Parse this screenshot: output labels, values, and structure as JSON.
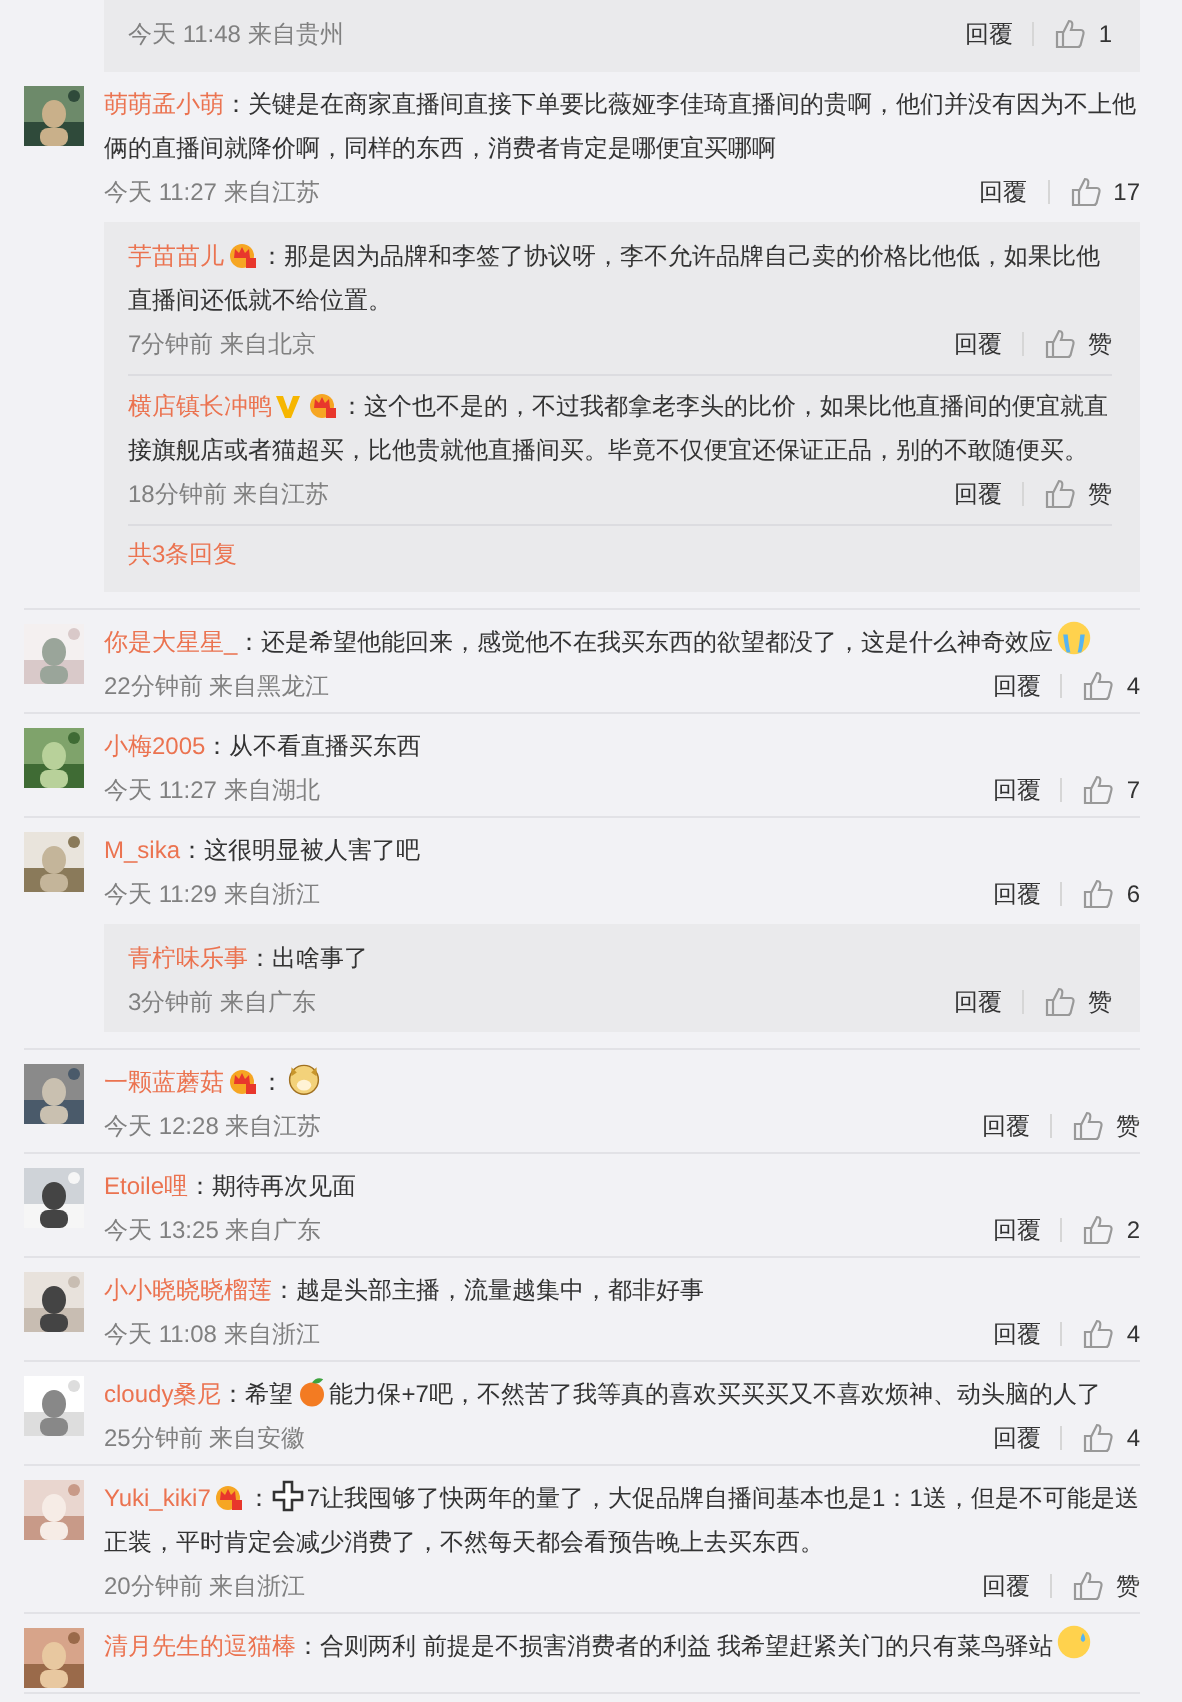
{
  "top_fragment": {
    "meta": "今天 11:48 来自贵州",
    "reply_label": "回覆",
    "likes": "1"
  },
  "comments": [
    {
      "name": "萌萌孟小萌",
      "segments": [
        {
          "kind": "text",
          "value": "：关键是在商家直播间直接下单要比薇娅李佳琦直播间的贵啊，他们并没有因为不上他俩的直播间就降价啊，同样的东西，消费者肯定是哪便宜买哪啊"
        }
      ],
      "meta": "今天 11:27 来自江苏",
      "reply_label": "回覆",
      "likes": "17",
      "replies": [
        {
          "name": "芋苗苗儿",
          "badges": [
            {
              "kind": "member"
            }
          ],
          "segments": [
            {
              "kind": "text",
              "value": "：那是因为品牌和李签了协议呀，李不允许品牌自己卖的价格比他低，如果比他直播间还低就不给位置。"
            }
          ],
          "meta": "7分钟前 来自北京",
          "reply_label": "回覆",
          "likes": "赞"
        },
        {
          "name": "横店镇长冲鸭",
          "badges": [
            {
              "kind": "verified"
            },
            {
              "kind": "member"
            }
          ],
          "segments": [
            {
              "kind": "text",
              "value": "：这个也不是的，不过我都拿老李头的比价，如果比他直播间的便宜就直接旗舰店或者猫超买，比他贵就他直播间买。毕竟不仅便宜还保证正品，别的不敢随便买。"
            }
          ],
          "meta": "18分钟前 来自江苏",
          "reply_label": "回覆",
          "likes": "赞"
        }
      ],
      "more": "共3条回复"
    },
    {
      "name": "你是大星星_",
      "segments": [
        {
          "kind": "text",
          "value": "：还是希望他能回来，感觉他不在我买东西的欲望都没了，这是什么神奇效应"
        },
        {
          "kind": "crying"
        }
      ],
      "meta": "22分钟前 来自黑龙江",
      "reply_label": "回覆",
      "likes": "4"
    },
    {
      "name": "小梅2005",
      "segments": [
        {
          "kind": "text",
          "value": "：从不看直播买东西"
        }
      ],
      "meta": "今天 11:27 来自湖北",
      "reply_label": "回覆",
      "likes": "7"
    },
    {
      "name": "M_sika",
      "segments": [
        {
          "kind": "text",
          "value": "：这很明显被人害了吧"
        }
      ],
      "meta": "今天 11:29 来自浙江",
      "reply_label": "回覆",
      "likes": "6",
      "replies": [
        {
          "name": "青柠味乐事",
          "segments": [
            {
              "kind": "text",
              "value": "：出啥事了"
            }
          ],
          "meta": "3分钟前 来自广东",
          "reply_label": "回覆",
          "likes": "赞"
        }
      ]
    },
    {
      "name": "一颗蓝蘑菇",
      "badges": [
        {
          "kind": "member"
        }
      ],
      "segments": [
        {
          "kind": "text",
          "value": "："
        },
        {
          "kind": "dog"
        }
      ],
      "meta": "今天 12:28 来自江苏",
      "reply_label": "回覆",
      "likes": "赞"
    },
    {
      "name": "Etoile哩",
      "segments": [
        {
          "kind": "text",
          "value": "：期待再次见面"
        }
      ],
      "meta": "今天 13:25 来自广东",
      "reply_label": "回覆",
      "likes": "2"
    },
    {
      "name": "小小晓晓晓榴莲",
      "segments": [
        {
          "kind": "text",
          "value": "：越是头部主播，流量越集中，都非好事"
        }
      ],
      "meta": "今天 11:08 来自浙江",
      "reply_label": "回覆",
      "likes": "4"
    },
    {
      "name": "cloudy桑尼",
      "segments": [
        {
          "kind": "text",
          "value": "：希望"
        },
        {
          "kind": "orange"
        },
        {
          "kind": "text",
          "value": "能力保+7吧，不然苦了我等真的喜欢买买买又不喜欢烦神、动头脑的人了"
        }
      ],
      "meta": "25分钟前 来自安徽",
      "reply_label": "回覆",
      "likes": "4"
    },
    {
      "name": "Yuki_kiki7",
      "badges": [
        {
          "kind": "member"
        }
      ],
      "segments": [
        {
          "kind": "text",
          "value": "："
        },
        {
          "kind": "cross"
        },
        {
          "kind": "text",
          "value": "7让我囤够了快两年的量了，大促品牌自播间基本也是1：1送，但是不可能是送正装，平时肯定会减少消费了，不然每天都会看预告晚上去买东西。"
        }
      ],
      "meta": "20分钟前 来自浙江",
      "reply_label": "回覆",
      "likes": "赞"
    },
    {
      "name": "清月先生的逗猫棒",
      "segments": [
        {
          "kind": "text",
          "value": "：合则两利 前提是不损害消费者的利益 我希望赶紧关门的只有菜鸟驿站"
        },
        {
          "kind": "sweat"
        }
      ]
    }
  ]
}
